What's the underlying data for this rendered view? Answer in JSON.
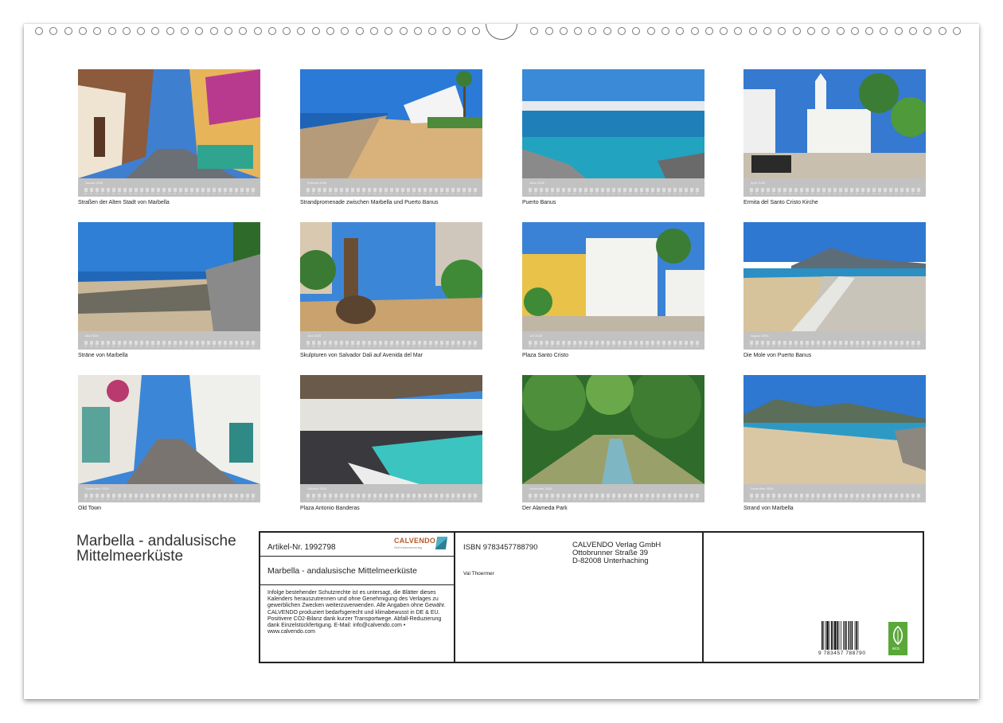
{
  "thumbnails": [
    {
      "month": "Januar 2026",
      "caption": "Straßen der Alten Stadt von Marbella"
    },
    {
      "month": "Februar 2026",
      "caption": "Strandpromenade zwischen Marbella und Puerto Banus"
    },
    {
      "month": "März 2026",
      "caption": "Puerto Banus"
    },
    {
      "month": "April 2026",
      "caption": "Ermita del Santo Cristo Kirche"
    },
    {
      "month": "Mai 2026",
      "caption": "Sträne von Marbella"
    },
    {
      "month": "Juni 2026",
      "caption": "Skulpturen von Salvador Dali auf Avenida del Mar"
    },
    {
      "month": "Juli 2026",
      "caption": "Plaza Santo Cristo"
    },
    {
      "month": "August 2026",
      "caption": "Die Mole von Puerto Banus"
    },
    {
      "month": "September 2026",
      "caption": "Old Town"
    },
    {
      "month": "Oktober 2026",
      "caption": "Plaza Antonio Banderas"
    },
    {
      "month": "November 2026",
      "caption": "Der Alameda Park"
    },
    {
      "month": "Dezember 2026",
      "caption": "Strand von Marbella"
    }
  ],
  "cover_title": "Marbella - andalusische Mittelmeerküste",
  "info": {
    "article": "Artikel-Nr. 1992798",
    "logo_text": "CALVENDO",
    "logo_sub": "Seit Kalenderverlag",
    "title": "Marbella - andalusische Mittelmeerküste",
    "legal": "Infolge bestehender Schutzrechte ist es untersagt, die Blätter dieses Kalenders herauszutrennen und ohne Genehmigung des Verlages zu gewerblichen Zwecken weiterzuverwenden. Alle Angaben ohne Gewähr. CALVENDO produziert bedarfsgerecht und klimabewusst in DE & EU. Positivere CO2-Bilanz dank kurzer Transportwege. Abfall-Reduzierung dank Einzelstückfertigung. E-Mail: info@calvendo.com • www.calvendo.com",
    "isbn": "ISBN 9783457788790",
    "publisher_line1": "CALVENDO Verlag GmbH",
    "publisher_line2": "Ottobrunner Straße 39",
    "publisher_line3": "D-82008 Unterhaching",
    "author": "Val Thoermer",
    "barcode_number": "9 783457 788790",
    "eco_label": "eco"
  },
  "colors": {
    "calendar_bar": "#c2c2c2",
    "border": "#222222",
    "eco_green": "#5aa839",
    "logo_orange": "#b5592a"
  }
}
